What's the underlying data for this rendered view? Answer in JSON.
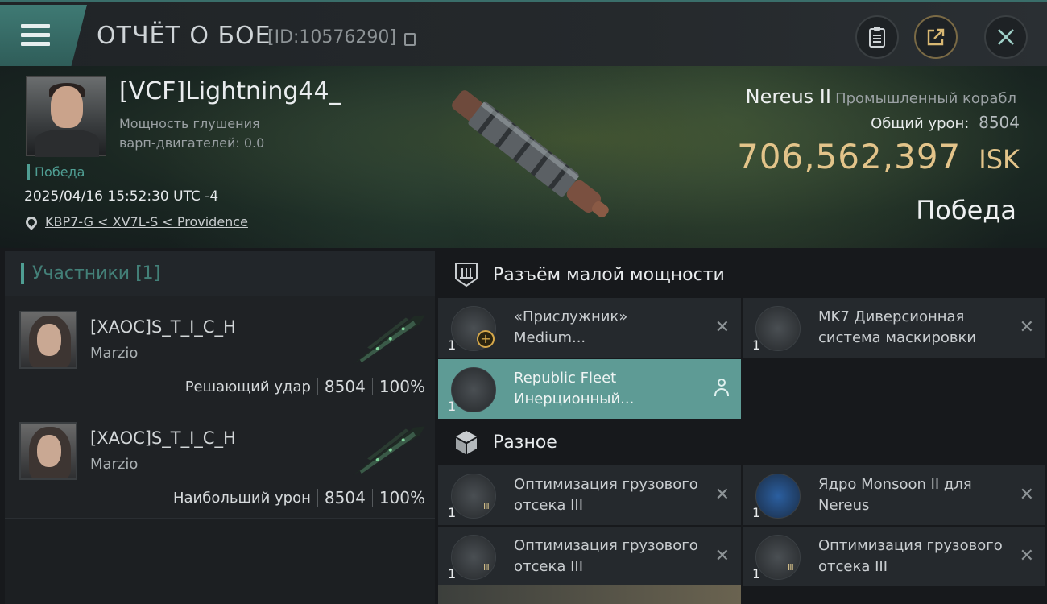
{
  "header": {
    "title": "ОТЧЁТ О БОЕ",
    "report_id": "[ID:10576290]",
    "icons": [
      "menu-icon",
      "copy-icon",
      "clipboard-icon",
      "share-icon",
      "close-icon"
    ]
  },
  "victim": {
    "pilot_name": "[VCF]Lightning44_",
    "warp_scramble_label": "Мощность глушения варп-двигателей: 0.0",
    "status_tag": "Победа",
    "datetime": "2025/04/16 15:52:30 UTC -4",
    "location": "KBP7-G < XV7L-S < Providence",
    "ship_name": "Nereus II",
    "ship_class": "Промышленный корабл",
    "total_damage_label": "Общий урон:",
    "total_damage_value": "8504",
    "isk_value": "706,562,397",
    "isk_unit": "ISK",
    "result": "Победа"
  },
  "participants": {
    "label": "Участники",
    "count": "[1]",
    "entries": [
      {
        "name": "[XAOC]S_T_I_C_H",
        "ship": "Marzio",
        "role": "Решающий удар",
        "damage": "8504",
        "percent": "100%"
      },
      {
        "name": "[XAOC]S_T_I_C_H",
        "ship": "Marzio",
        "role": "Наибольший урон",
        "damage": "8504",
        "percent": "100%"
      }
    ]
  },
  "sections": [
    {
      "title": "Разъём малой мощности",
      "modules": [
        {
          "qty": "1",
          "name": "«Прислужник» Medium...",
          "action": "remove"
        },
        {
          "qty": "1",
          "name": "MK7 Диверсионная система маскировки",
          "action": "remove"
        },
        {
          "qty": "1",
          "name": "Republic Fleet Инерционный...",
          "action": "person",
          "selected": true
        }
      ]
    },
    {
      "title": "Разное",
      "modules": [
        {
          "qty": "1",
          "name": "Оптимизация грузового отсека III",
          "action": "remove"
        },
        {
          "qty": "1",
          "name": "Ядро Monsoon II для Nereus",
          "action": "remove"
        },
        {
          "qty": "1",
          "name": "Оптимизация грузового отсека III",
          "action": "remove"
        },
        {
          "qty": "1",
          "name": "Оптимизация грузового отсека III",
          "action": "remove"
        }
      ]
    }
  ],
  "ui": {
    "remove_glyph": "✕"
  },
  "colors": {
    "accent_teal": "#4f9e93",
    "isk_gold": "#e3c48a",
    "selected_module": "#5e9b95"
  }
}
